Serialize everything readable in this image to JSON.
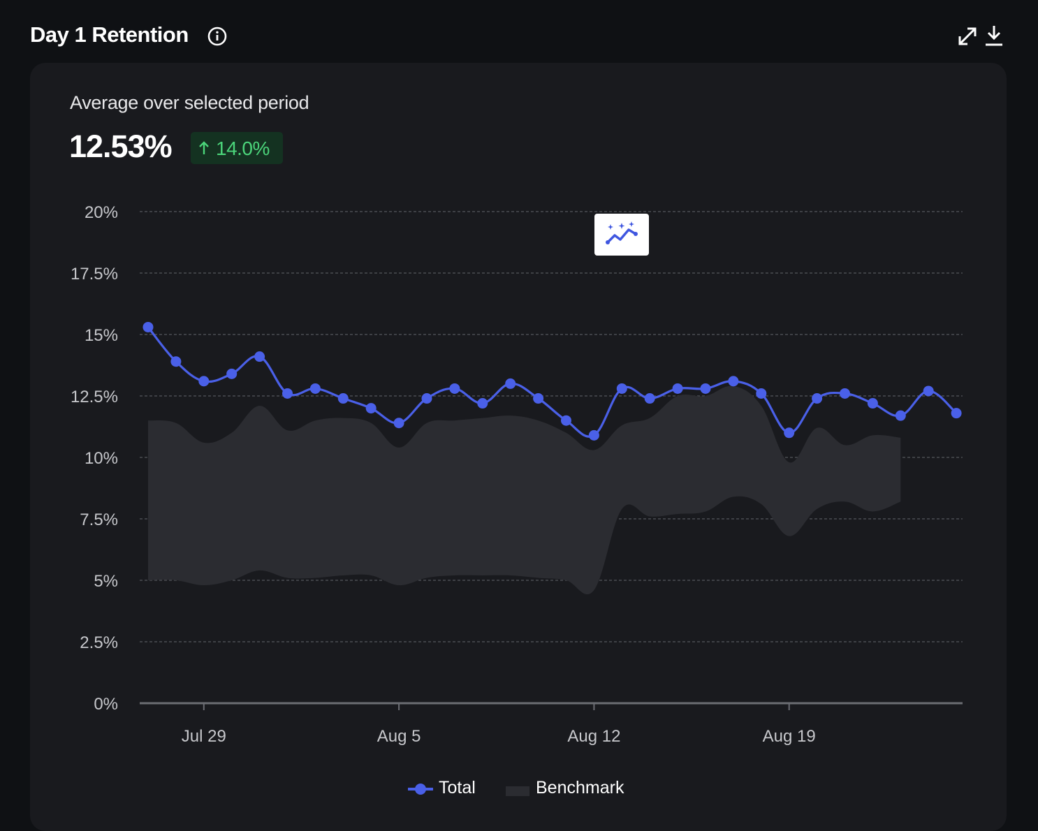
{
  "header": {
    "title": "Day 1 Retention",
    "info_icon": "info-circle-icon",
    "expand_icon": "expand-icon",
    "download_icon": "download-icon"
  },
  "summary": {
    "label": "Average over selected period",
    "value": "12.53%",
    "delta": "14.0%",
    "delta_direction": "up"
  },
  "insight_button": {
    "icon": "sparkle-trend-icon"
  },
  "colors": {
    "background": "#0f1114",
    "card": "#191a1e",
    "series_total": "#4a60e8",
    "benchmark_band": "#2b2c31",
    "delta_positive": "#4bd47a",
    "delta_badge_bg": "#143221",
    "grid": "#55575d",
    "tick_label": "#c7c8cc"
  },
  "chart_data": {
    "type": "line",
    "title": "",
    "xlabel": "",
    "ylabel": "",
    "y_tick_labels": [
      "0%",
      "2.5%",
      "5%",
      "7.5%",
      "10%",
      "12.5%",
      "15%",
      "17.5%",
      "20%"
    ],
    "y_ticks": [
      0,
      2.5,
      5,
      7.5,
      10,
      12.5,
      15,
      17.5,
      20
    ],
    "ylim": [
      0,
      20
    ],
    "x_tick_labels": [
      "Jul 29",
      "Aug 5",
      "Aug 12",
      "Aug 19"
    ],
    "x_tick_dates": [
      "Jul 29",
      "Aug 5",
      "Aug 12",
      "Aug 19"
    ],
    "dates": [
      "Jul 27",
      "Jul 28",
      "Jul 29",
      "Jul 30",
      "Jul 31",
      "Aug 1",
      "Aug 2",
      "Aug 3",
      "Aug 4",
      "Aug 5",
      "Aug 6",
      "Aug 7",
      "Aug 8",
      "Aug 9",
      "Aug 10",
      "Aug 11",
      "Aug 12",
      "Aug 13",
      "Aug 14",
      "Aug 15",
      "Aug 16",
      "Aug 17",
      "Aug 18",
      "Aug 19",
      "Aug 20",
      "Aug 21",
      "Aug 22",
      "Aug 23",
      "Aug 24",
      "Aug 25"
    ],
    "grid": "horizontal-dashed",
    "legend_position": "bottom-center",
    "series": [
      {
        "name": "Total",
        "type": "line",
        "values": [
          15.3,
          13.9,
          13.1,
          13.4,
          14.1,
          12.6,
          12.8,
          12.4,
          12.0,
          11.4,
          12.4,
          12.8,
          12.2,
          13.0,
          12.4,
          11.5,
          10.9,
          12.8,
          12.4,
          12.8,
          12.8,
          13.1,
          12.6,
          11.0,
          12.4,
          12.6,
          12.2,
          11.7,
          12.7,
          11.8
        ]
      },
      {
        "name": "Benchmark",
        "type": "band",
        "upper": [
          11.5,
          11.4,
          10.6,
          11.0,
          12.1,
          11.1,
          11.5,
          11.6,
          11.4,
          10.4,
          11.4,
          11.5,
          11.6,
          11.7,
          11.5,
          11.0,
          10.3,
          11.3,
          11.6,
          12.5,
          12.5,
          12.9,
          12.1,
          9.8,
          11.2,
          10.5,
          10.9,
          10.8
        ],
        "lower": [
          5.0,
          5.0,
          4.8,
          5.0,
          5.4,
          5.1,
          5.1,
          5.2,
          5.2,
          4.8,
          5.1,
          5.2,
          5.2,
          5.2,
          5.1,
          5.0,
          4.6,
          7.9,
          7.6,
          7.7,
          7.8,
          8.4,
          8.1,
          6.8,
          7.9,
          8.2,
          7.8,
          8.2
        ]
      }
    ]
  },
  "legend": {
    "total_label": "Total",
    "benchmark_label": "Benchmark"
  }
}
